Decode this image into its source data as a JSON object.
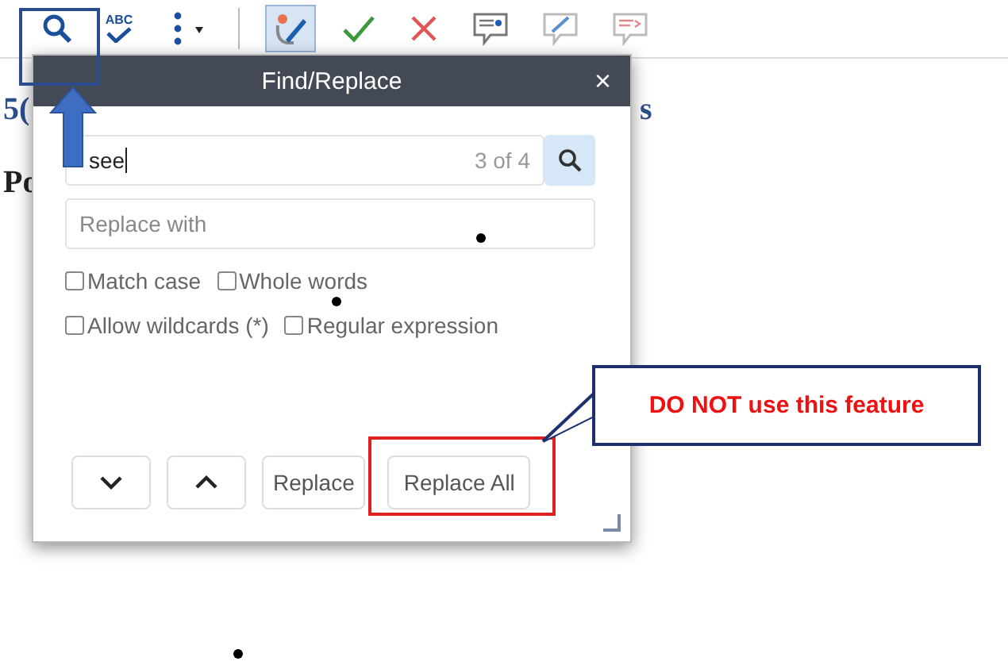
{
  "toolbar": {
    "items": [
      {
        "kind": "search",
        "selected": false
      },
      {
        "kind": "spell",
        "label": "ABC",
        "selected": false
      },
      {
        "kind": "more",
        "selected": false
      },
      {
        "kind": "track",
        "selected": true
      },
      {
        "kind": "accept",
        "selected": false
      },
      {
        "kind": "reject",
        "selected": false
      },
      {
        "kind": "comment-add",
        "selected": false
      },
      {
        "kind": "comment-edit",
        "selected": false
      },
      {
        "kind": "comment-delete",
        "selected": false
      }
    ]
  },
  "document": {
    "fragments": [
      "5(",
      "s",
      "Po"
    ]
  },
  "dialog": {
    "title": "Find/Replace",
    "close": "×",
    "find": {
      "value": "see",
      "count": "3 of 4"
    },
    "replace": {
      "placeholder": "Replace with"
    },
    "options": [
      [
        {
          "label": "Match case",
          "checked": false
        },
        {
          "label": "Whole words",
          "checked": false
        }
      ],
      [
        {
          "label": "Allow wildcards (*)",
          "checked": false
        },
        {
          "label": "Regular expression",
          "checked": false
        }
      ]
    ],
    "buttons": [
      {
        "kind": "next"
      },
      {
        "kind": "previous"
      },
      {
        "kind": "text",
        "label": "Replace"
      },
      {
        "kind": "text",
        "label": "Replace All"
      }
    ]
  },
  "callout": {
    "text": "DO NOT use this feature"
  }
}
